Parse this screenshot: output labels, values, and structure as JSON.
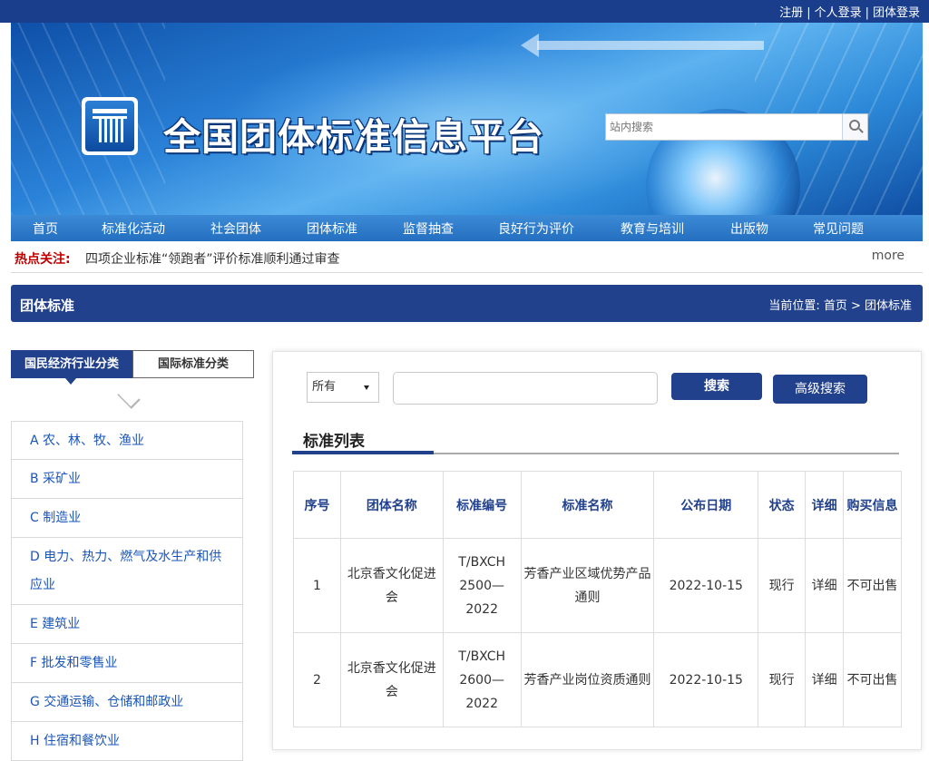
{
  "topbar": {
    "register": "注册",
    "personal_login": "个人登录",
    "group_login": "团体登录",
    "separator": "|"
  },
  "banner": {
    "site_title": "全国团体标准信息平台",
    "search_placeholder": "站内搜索"
  },
  "nav": [
    "首页",
    "标准化活动",
    "社会团体",
    "团体标准",
    "监督抽查",
    "良好行为评价",
    "教育与培训",
    "出版物",
    "常见问题"
  ],
  "hot": {
    "label": "热点关注:",
    "text": "四项企业标准“领跑者”评价标准顺利通过审查",
    "more": "more"
  },
  "section": {
    "title": "团体标准",
    "breadcrumb": "当前位置: 首页 > 团体标准"
  },
  "sidebar": {
    "tab_active": "国民经济行业分类",
    "tab_inactive": "国际标准分类",
    "categories": [
      "A 农、林、牧、渔业",
      "B 采矿业",
      "C 制造业",
      "D 电力、热力、燃气及水生产和供应业",
      "E 建筑业",
      "F 批发和零售业",
      "G 交通运输、仓储和邮政业",
      "H 住宿和餐饮业"
    ]
  },
  "search": {
    "scope_value": "所有",
    "keyword_value": "",
    "search_label": "搜索",
    "advanced_label": "高级搜索"
  },
  "list": {
    "title": "标准列表",
    "headers": [
      "序号",
      "团体名称",
      "标准编号",
      "标准名称",
      "公布日期",
      "状态",
      "详细",
      "购买信息"
    ],
    "rows": [
      [
        "1",
        "北京香文化促进会",
        "T/BXCH 2500—2022",
        "芳香产业区域优势产品通则",
        "2022-10-15",
        "现行",
        "详细",
        "不可出售"
      ],
      [
        "2",
        "北京香文化促进会",
        "T/BXCH 2600—2022",
        "芳香产业岗位资质通则",
        "2022-10-15",
        "现行",
        "详细",
        "不可出售"
      ]
    ]
  },
  "colors": {
    "primary": "#22418c",
    "nav": "#2a78c8",
    "link": "#1a55b8",
    "hot": "#c00000"
  }
}
